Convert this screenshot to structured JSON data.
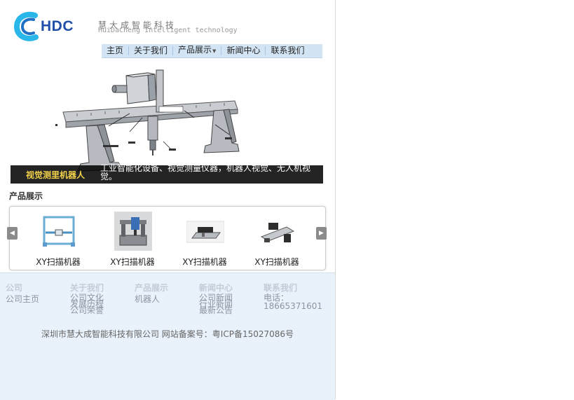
{
  "header": {
    "logo_text": "HDC",
    "tagline_cn": "慧大成智能科技",
    "tagline_en": "HuiDaCheng Intelligent technology"
  },
  "nav": {
    "items": [
      {
        "label": "主页"
      },
      {
        "label": "关于我们"
      },
      {
        "label": "产品展示",
        "has_dropdown": true
      },
      {
        "label": "新闻中心"
      },
      {
        "label": "联系我们"
      }
    ]
  },
  "banner": {
    "title": "视觉测里机器人",
    "description": "工业智能化设备、视觉测量仪器，机器人视觉、无人机视觉。"
  },
  "products": {
    "section_title": "产品展示",
    "prev_label": "◀",
    "next_label": "▶",
    "items": [
      {
        "label": "XY扫描机器",
        "icon": "xy-frame-icon"
      },
      {
        "label": "XY扫描机器",
        "icon": "gantry-robot-icon"
      },
      {
        "label": "XY扫描机器",
        "icon": "scanner-plate-icon"
      },
      {
        "label": "XY扫描机器",
        "icon": "linear-stage-icon"
      }
    ]
  },
  "footer": {
    "columns": [
      {
        "heading": "公司",
        "links": [
          "公司主页"
        ]
      },
      {
        "heading": "关于我们",
        "links": [
          "公司文化",
          "发展历程",
          "公司荣誉"
        ]
      },
      {
        "heading": "产品展示",
        "links": [
          "机器人"
        ]
      },
      {
        "heading": "新闻中心",
        "links": [
          "公司新闻",
          "行业新闻",
          "最新公告"
        ]
      },
      {
        "heading": "联系我们",
        "lines": [
          "电话：",
          "18665371601"
        ]
      }
    ],
    "copyright": "深圳市慧大成智能科技有限公司 网站备案号：粤ICP备15027086号"
  },
  "colors": {
    "brand_blue": "#1f4fa8",
    "logo_cyan": "#29b6e8",
    "nav_bg": "#d3e5f5",
    "caption_title": "#f2d24b",
    "footer_bg": "#e9f1fa"
  }
}
